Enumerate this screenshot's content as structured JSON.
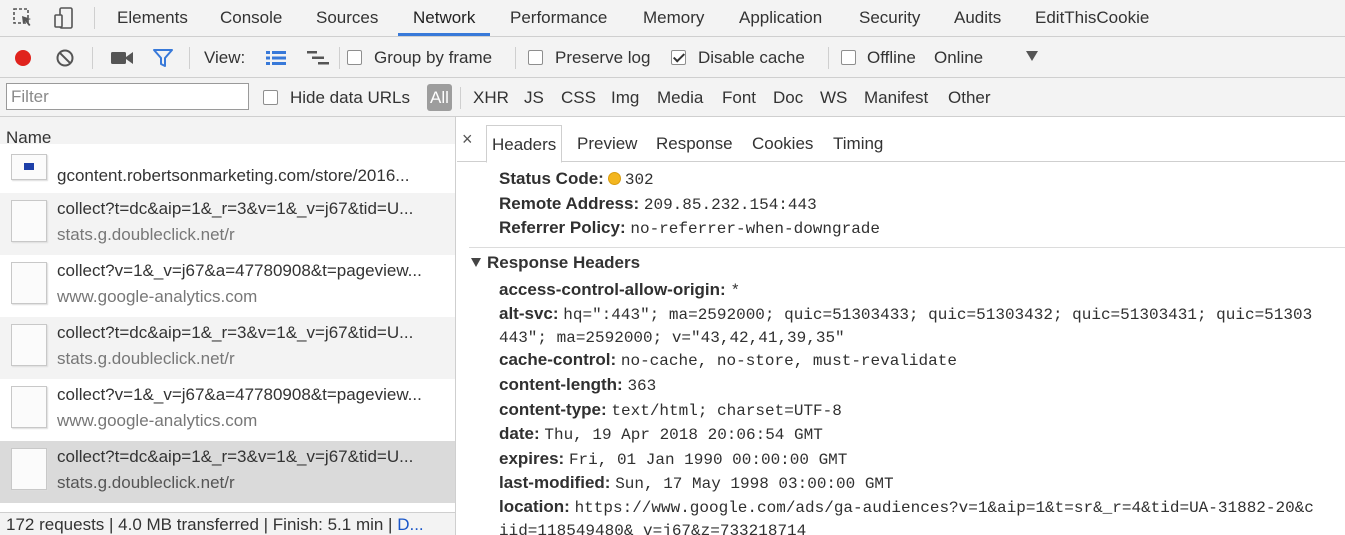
{
  "tabs": [
    "Elements",
    "Console",
    "Sources",
    "Network",
    "Performance",
    "Memory",
    "Application",
    "Security",
    "Audits",
    "EditThisCookie"
  ],
  "toolbar": {
    "view_label": "View:",
    "group_by_frame": "Group by frame",
    "preserve_log": "Preserve log",
    "disable_cache": "Disable cache",
    "offline": "Offline",
    "throttle": "Online",
    "colors": {
      "record": "#e0231d",
      "filter_active": "#3879d9"
    }
  },
  "filterbar": {
    "placeholder": "Filter",
    "hide_data_urls": "Hide data URLs",
    "types": [
      "All",
      "XHR",
      "JS",
      "CSS",
      "Img",
      "Media",
      "Font",
      "Doc",
      "WS",
      "Manifest",
      "Other"
    ]
  },
  "left": {
    "name_header": "Name",
    "rows": [
      {
        "name": "gcontent.robertsonmarketing.com/store/2016...",
        "domain": ""
      },
      {
        "name": "collect?t=dc&aip=1&_r=3&v=1&_v=j67&tid=U...",
        "domain": "stats.g.doubleclick.net/r"
      },
      {
        "name": "collect?v=1&_v=j67&a=47780908&t=pageview...",
        "domain": "www.google-analytics.com"
      },
      {
        "name": "collect?t=dc&aip=1&_r=3&v=1&_v=j67&tid=U...",
        "domain": "stats.g.doubleclick.net/r"
      },
      {
        "name": "collect?v=1&_v=j67&a=47780908&t=pageview...",
        "domain": "www.google-analytics.com"
      },
      {
        "name": "collect?t=dc&aip=1&_r=3&v=1&_v=j67&tid=U...",
        "domain": "stats.g.doubleclick.net/r"
      }
    ],
    "status": "172 requests | 4.0 MB transferred | Finish: 5.1 min | ",
    "status_link": "D..."
  },
  "detail": {
    "close": "×",
    "tabs": [
      "Headers",
      "Preview",
      "Response",
      "Cookies",
      "Timing"
    ],
    "general": [
      {
        "key": "Status Code:",
        "value": "302"
      },
      {
        "key": "Remote Address:",
        "value": "209.85.232.154:443"
      },
      {
        "key": "Referrer Policy:",
        "value": "no-referrer-when-downgrade"
      }
    ],
    "response_headers_title": "Response Headers",
    "response_headers": [
      {
        "key": "access-control-allow-origin:",
        "value": "*"
      },
      {
        "key": "alt-svc:",
        "value": "hq=\":443\"; ma=2592000; quic=51303433; quic=51303432; quic=51303431; quic=51303"
      },
      {
        "key": "",
        "value": "443\"; ma=2592000; v=\"43,42,41,39,35\""
      },
      {
        "key": "cache-control:",
        "value": "no-cache, no-store, must-revalidate"
      },
      {
        "key": "content-length:",
        "value": "363"
      },
      {
        "key": "content-type:",
        "value": "text/html; charset=UTF-8"
      },
      {
        "key": "date:",
        "value": "Thu, 19 Apr 2018 20:06:54 GMT"
      },
      {
        "key": "expires:",
        "value": "Fri, 01 Jan 1990 00:00:00 GMT"
      },
      {
        "key": "last-modified:",
        "value": "Sun, 17 May 1998 03:00:00 GMT"
      },
      {
        "key": "location:",
        "value": "https://www.google.com/ads/ga-audiences?v=1&aip=1&t=sr&_r=4&tid=UA-31882-20&c"
      },
      {
        "key": "",
        "value": "iid=118549480&_v=j67&z=733218714"
      }
    ],
    "colors": {
      "status_dot": "#f3b61f"
    }
  }
}
